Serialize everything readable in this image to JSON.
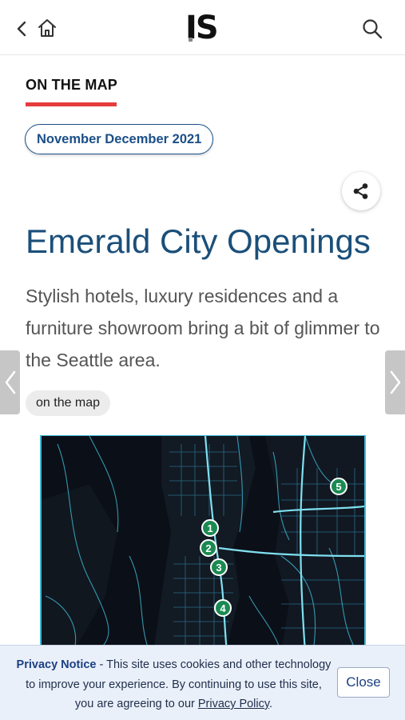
{
  "header": {
    "logo_text": "IS",
    "icons": [
      "back-chevron-icon",
      "home-icon",
      "search-icon"
    ]
  },
  "section": {
    "label": "ON THE MAP"
  },
  "issue": {
    "label": "November December 2021"
  },
  "share": {
    "icon": "share-icon"
  },
  "article": {
    "title": "Emerald City Openings",
    "subtitle": "Stylish hotels, luxury residences and a furniture showroom bring a bit of glimmer to the Seattle area.",
    "tag": "on the map"
  },
  "map": {
    "pins": [
      "1",
      "2",
      "3",
      "4",
      "5"
    ]
  },
  "privacy": {
    "heading": "Privacy Notice",
    "body": " - This site uses cookies and other technology to improve your experience. By continuing to use this site, you are agreeing to our ",
    "link_text": "Privacy Policy",
    "end": ".",
    "close_label": "Close"
  },
  "colors": {
    "accent_red": "#e53b3b",
    "brand_blue": "#1b4f87",
    "map_bg": "#0b0f17",
    "map_roads": "#3fb8d4",
    "pin_green": "#1a8a52"
  }
}
